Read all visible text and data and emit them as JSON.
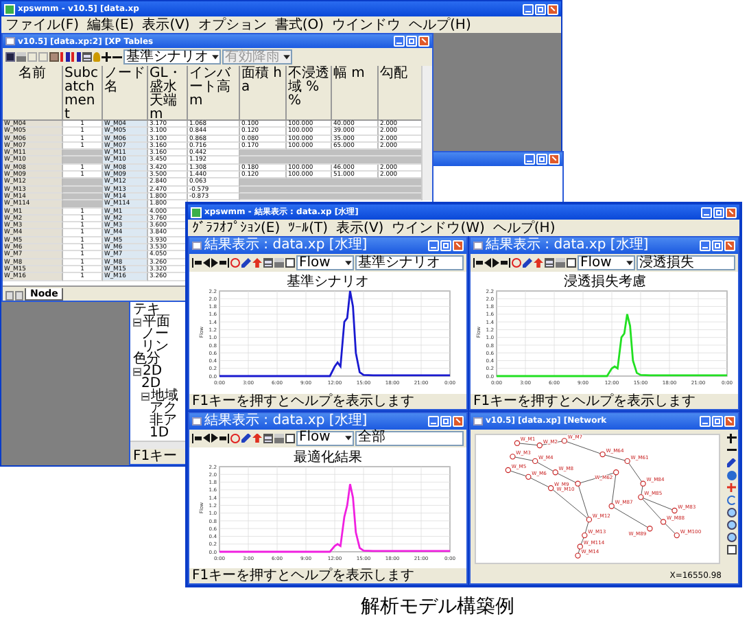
{
  "main_window": {
    "title": "xpswmm - v10.5] [data.xp",
    "menu": [
      "ファイル(F)",
      "編集(E)",
      "表示(V)",
      "オプション",
      "書式(O)",
      "ウインドウ",
      "ヘルプ(H)"
    ]
  },
  "tables_window": {
    "title": "v10.5] [data.xp:2] [XP Tables",
    "scenario_select": "基準シナリオ",
    "rain_select": {
      "value": "有効降雨",
      "disabled": true
    },
    "columns": [
      "名前",
      "Subcatchment",
      "ノード名",
      "GL・盛水天端 m",
      "インバート高 m",
      "面積 ha",
      "不浸透域 % %",
      "幅 m",
      "勾配"
    ],
    "rows": [
      {
        "linked": true,
        "name": "W_M04",
        "subcatchment": "1",
        "node": "W_M04",
        "levels": [
          "3.170",
          "1.068"
        ],
        "runoff": [
          "0.100",
          "100.000",
          "40.000",
          "2.000"
        ]
      },
      {
        "linked": true,
        "name": "W_M05",
        "subcatchment": "1",
        "node": "W_M05",
        "levels": [
          "3.100",
          "0.844"
        ],
        "runoff": [
          "0.120",
          "100.000",
          "39.000",
          "2.000"
        ]
      },
      {
        "linked": true,
        "name": "W_M06",
        "subcatchment": "1",
        "node": "W_M06",
        "levels": [
          "3.100",
          "0.868"
        ],
        "runoff": [
          "0.080",
          "100.000",
          "35.000",
          "2.000"
        ]
      },
      {
        "linked": true,
        "name": "W_M07",
        "subcatchment": "1",
        "node": "W_M07",
        "levels": [
          "3.160",
          "0.716"
        ],
        "runoff": [
          "0.170",
          "100.000",
          "65.000",
          "2.000"
        ]
      },
      {
        "linked": false,
        "name": "W_M11",
        "node": "W_M11",
        "levels": [
          "3.160",
          "0.442"
        ]
      },
      {
        "linked": false,
        "name": "W_M10",
        "node": "W_M10",
        "levels": [
          "3.450",
          "1.192"
        ]
      },
      {
        "linked": true,
        "name": "W_M08",
        "subcatchment": "1",
        "node": "W_M08",
        "levels": [
          "3.420",
          "1.308"
        ],
        "runoff": [
          "0.180",
          "100.000",
          "46.000",
          "2.000"
        ]
      },
      {
        "linked": true,
        "name": "W_M09",
        "subcatchment": "1",
        "node": "W_M09",
        "levels": [
          "3.500",
          "1.440"
        ],
        "runoff": [
          "0.120",
          "100.000",
          "51.000",
          "2.000"
        ]
      },
      {
        "linked": false,
        "name": "W_M12",
        "node": "W_M12",
        "levels": [
          "2.840",
          "0.063"
        ]
      },
      {
        "linked": false,
        "name": "W_M13",
        "node": "W_M13",
        "levels": [
          "2.470",
          "-0.579"
        ]
      },
      {
        "linked": false,
        "name": "W_M14",
        "node": "W_M14",
        "levels": [
          "1.800",
          "-0.873"
        ]
      },
      {
        "linked": false,
        "name": "W_M114",
        "node": "W_M114",
        "levels": [
          "1.800"
        ]
      },
      {
        "linked": true,
        "name": "W_M1",
        "subcatchment": "1",
        "node": "W_M1",
        "levels": [
          "4.000"
        ]
      },
      {
        "linked": true,
        "name": "W_M2",
        "subcatchment": "1",
        "node": "W_M2",
        "levels": [
          "3.760"
        ]
      },
      {
        "linked": true,
        "name": "W_M3",
        "subcatchment": "1",
        "node": "W_M3",
        "levels": [
          "3.600"
        ]
      },
      {
        "linked": true,
        "name": "W_M4",
        "subcatchment": "1",
        "node": "W_M4",
        "levels": [
          "3.840"
        ]
      },
      {
        "linked": true,
        "name": "W_M5",
        "subcatchment": "1",
        "node": "W_M5",
        "levels": [
          "3.930"
        ]
      },
      {
        "linked": true,
        "name": "W_M6",
        "subcatchment": "1",
        "node": "W_M6",
        "levels": [
          "3.530"
        ]
      },
      {
        "linked": true,
        "name": "W_M7",
        "subcatchment": "1",
        "node": "W_M7",
        "levels": [
          "4.050"
        ]
      },
      {
        "linked": true,
        "name": "W_M8",
        "subcatchment": "1",
        "node": "W_M8",
        "levels": [
          "3.260"
        ]
      },
      {
        "linked": true,
        "name": "W_M15",
        "subcatchment": "1",
        "node": "W_M15",
        "levels": [
          "3.320"
        ]
      },
      {
        "linked": true,
        "name": "W_M16",
        "subcatchment": "1",
        "node": "W_M16",
        "levels": [
          "3.260"
        ]
      }
    ],
    "tabs": [
      {
        "label": "Node",
        "selected": true
      }
    ]
  },
  "tree_window": {
    "items": [
      {
        "label": "テキ"
      },
      {
        "label": "平面",
        "expanded": true,
        "children": [
          {
            "label": "ノー"
          },
          {
            "label": "リン"
          }
        ]
      },
      {
        "label": "色分"
      },
      {
        "label": "2D",
        "expanded": true,
        "children": [
          {
            "label": "2D"
          },
          {
            "label": "地域",
            "expanded": true,
            "children": [
              {
                "label": "アク"
              },
              {
                "label": "非ア"
              },
              {
                "label": "1D"
              }
            ]
          }
        ]
      }
    ],
    "status": "F1キー"
  },
  "result_window": {
    "title": "xpswmm - 結果表示 : data.xp [水理]",
    "menu": [
      "ｸﾞﾗﾌｵﾌﾟｼｮﾝ(E)",
      "ﾂｰﾙ(T)",
      "表示(V)",
      "ウインドウ(W)",
      "ヘルプ(H)"
    ],
    "charts": [
      {
        "title": "結果表示 : data.xp [水理]",
        "variable": "Flow",
        "scenario": "基準シナリオ",
        "status": "F1キーを押すとヘルプを表示します",
        "chart_data": {
          "type": "line",
          "grid": true,
          "title": "基準シナリオ",
          "x": [
            0,
            11.5,
            12,
            12.3,
            12.6,
            13,
            13.3,
            13.6,
            13.9,
            14.2,
            14.6,
            15,
            16,
            24
          ],
          "series": [
            {
              "name": "Flow",
              "color": "#1a1ad0",
              "values": [
                0,
                0,
                0.25,
                0.35,
                0.25,
                1.4,
                1.5,
                2.2,
                1.8,
                0.6,
                0.1,
                0.03,
                0.02,
                0.02
              ]
            }
          ],
          "xlim": [
            0,
            24
          ],
          "ylim": [
            0,
            2.2
          ],
          "xticks": [
            {
              "value": 0,
              "label": "0:00"
            },
            {
              "value": 3,
              "label": "3:00"
            },
            {
              "value": 6,
              "label": "6:00"
            },
            {
              "value": 9,
              "label": "9:00"
            },
            {
              "value": 12,
              "label": "12:00"
            },
            {
              "value": 15,
              "label": "15:00"
            },
            {
              "value": 18,
              "label": "18:00"
            },
            {
              "value": 21,
              "label": "21:00"
            },
            {
              "value": 24,
              "label": "0:00"
            }
          ],
          "yticks": [
            {
              "value": 0,
              "label": "0.0"
            },
            0.2,
            0.4,
            0.6,
            0.8,
            {
              "value": 1,
              "label": "1.0"
            },
            1.2,
            1.4,
            1.6,
            1.8,
            {
              "value": 2,
              "label": "2.0"
            },
            2.2
          ]
        }
      },
      {
        "title": "結果表示 : data.xp [水理]",
        "variable": "Flow",
        "scenario": "浸透損失",
        "status": "F1キーを押すとヘルプを表示します",
        "chart_data": {
          "type": "line",
          "grid": true,
          "title": "浸透損失考慮",
          "x": [
            0,
            11.5,
            12,
            12.3,
            12.6,
            13,
            13.3,
            13.6,
            13.9,
            14.2,
            14.6,
            15,
            16,
            24
          ],
          "series": [
            {
              "name": "Flow",
              "color": "#22e022",
              "values": [
                0,
                0,
                0.2,
                0.25,
                0.2,
                1,
                1.1,
                1.6,
                1.3,
                0.4,
                0.08,
                0.03,
                0.02,
                0.02
              ]
            }
          ],
          "xlim": [
            0,
            24
          ],
          "ylim": [
            0,
            2.2
          ],
          "xticks": [
            {
              "value": 0,
              "label": "0:00"
            },
            {
              "value": 3,
              "label": "3:00"
            },
            {
              "value": 6,
              "label": "6:00"
            },
            {
              "value": 9,
              "label": "9:00"
            },
            {
              "value": 12,
              "label": "12:00"
            },
            {
              "value": 15,
              "label": "15:00"
            },
            {
              "value": 18,
              "label": "18:00"
            },
            {
              "value": 21,
              "label": "21:00"
            },
            {
              "value": 24,
              "label": "0:00"
            }
          ],
          "yticks": [
            {
              "value": 0,
              "label": "0.0"
            },
            0.2,
            0.4,
            0.6,
            0.8,
            {
              "value": 1,
              "label": "1.0"
            },
            1.2,
            1.4,
            1.6,
            1.8,
            {
              "value": 2,
              "label": "2.0"
            },
            2.2
          ]
        }
      },
      {
        "title": "結果表示 : data.xp [水理]",
        "variable": "Flow",
        "scenario": "全部",
        "status": "F1キーを押すとヘルプを表示します",
        "chart_data": {
          "type": "line",
          "grid": true,
          "title": "最適化結果",
          "x": [
            0,
            11.5,
            12,
            12.3,
            12.6,
            13,
            13.3,
            13.6,
            13.9,
            14.2,
            14.6,
            15,
            16,
            24
          ],
          "series": [
            {
              "name": "Flow",
              "color": "#f020e0",
              "values": [
                0,
                0,
                0.15,
                0.2,
                0.15,
                0.9,
                1.2,
                1.75,
                1.4,
                0.5,
                0.1,
                0.03,
                0.02,
                0.02
              ]
            }
          ],
          "xlim": [
            0,
            24
          ],
          "ylim": [
            0,
            2.2
          ],
          "xticks": [
            {
              "value": 0,
              "label": "0:00"
            },
            {
              "value": 3,
              "label": "3:00"
            },
            {
              "value": 6,
              "label": "6:00"
            },
            {
              "value": 9,
              "label": "9:00"
            },
            {
              "value": 12,
              "label": "12:00"
            },
            {
              "value": 15,
              "label": "15:00"
            },
            {
              "value": 18,
              "label": "18:00"
            },
            {
              "value": 21,
              "label": "21:00"
            },
            {
              "value": 24,
              "label": "0:00"
            }
          ],
          "yticks": [
            {
              "value": 0,
              "label": "0.0"
            },
            0.2,
            0.4,
            0.6,
            0.8,
            {
              "value": 1,
              "label": "1.0"
            },
            1.2,
            1.4,
            1.6,
            1.8,
            {
              "value": 2,
              "label": "2.0"
            },
            2.2
          ]
        }
      }
    ],
    "network": {
      "title": "v10.5] [data.xp] [Network",
      "nodes": [
        "W_M1",
        "W_M2",
        "W_M7",
        "W_M3",
        "W_M4",
        "W_M5",
        "W_M6",
        "W_M8",
        "W_M9",
        "W_M10",
        "W_M64",
        "W_M61",
        "W_M62",
        "W_M84",
        "W_M85",
        "W_M87",
        "W_M83",
        "W_M88",
        "W_M89",
        "W_M100",
        "W_M12",
        "W_M13",
        "W_M114",
        "W_M14"
      ],
      "status": "X=16550.98"
    }
  },
  "caption": "解析モデル構築例"
}
